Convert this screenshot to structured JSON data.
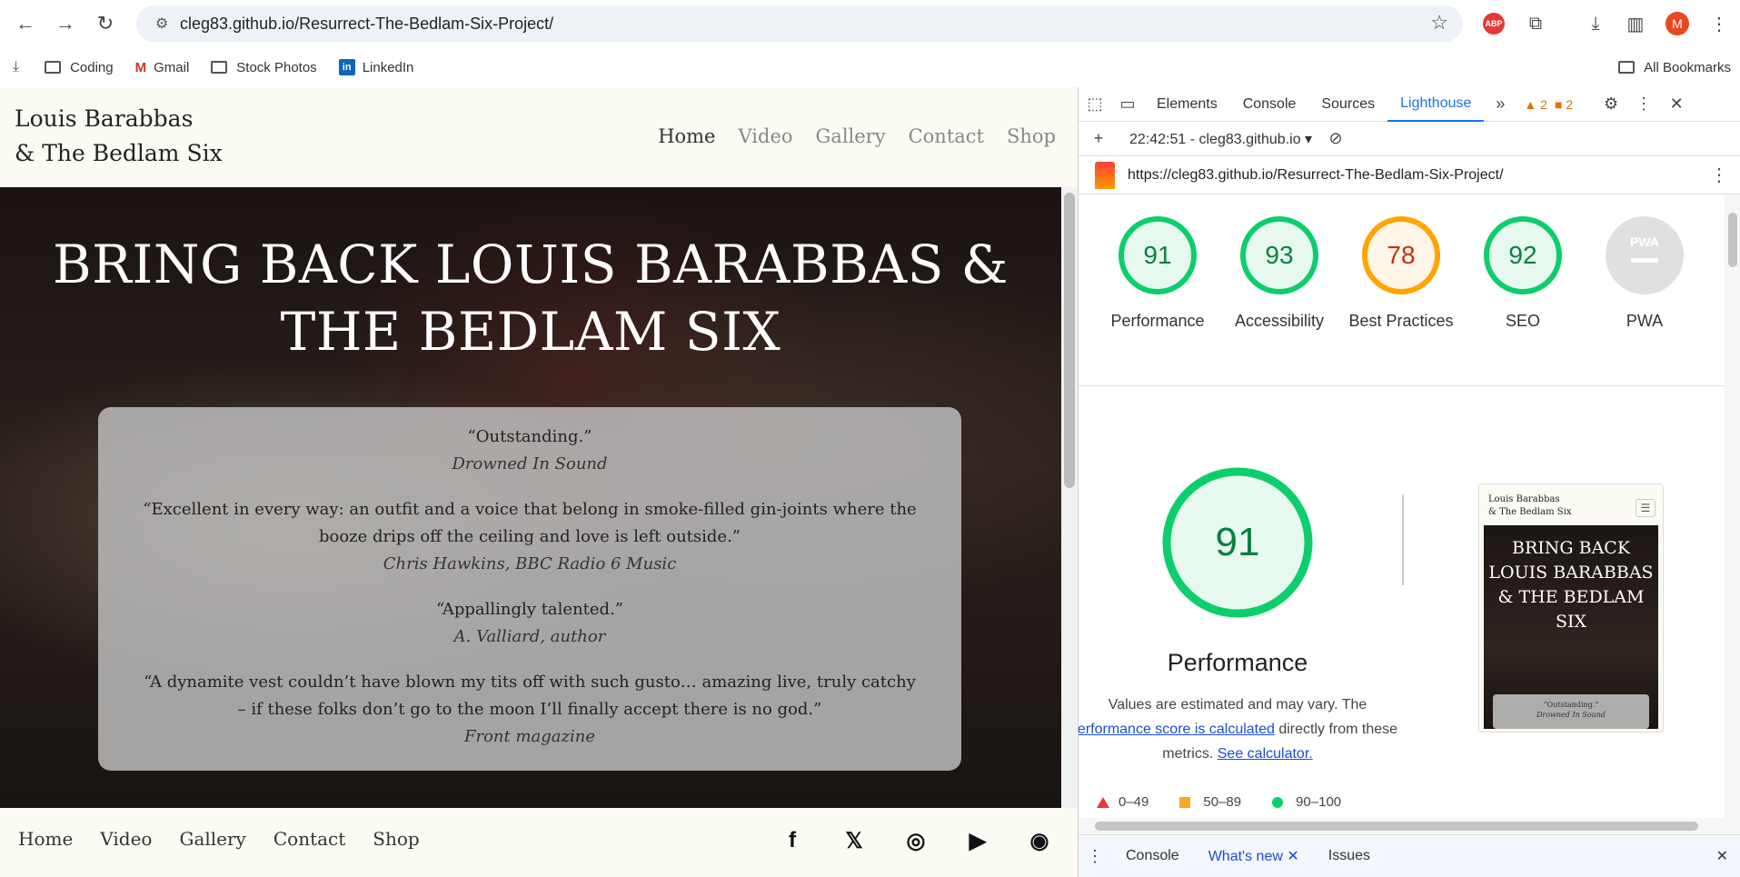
{
  "browser": {
    "url": "cleg83.github.io/Resurrect-The-Bedlam-Six-Project/",
    "avatar_letter": "M",
    "abp_label": "ABP",
    "bookmarks": [
      "Coding",
      "Gmail",
      "Stock Photos",
      "LinkedIn"
    ],
    "all_bookmarks": "All Bookmarks"
  },
  "site": {
    "logo_line1": "Louis Barabbas",
    "logo_line2": "& The Bedlam Six",
    "nav": [
      "Home",
      "Video",
      "Gallery",
      "Contact",
      "Shop"
    ],
    "hero_title": "BRING BACK LOUIS BARABBAS & THE BEDLAM SIX",
    "quotes": [
      {
        "text": "“Outstanding.”",
        "source": "Drowned In Sound"
      },
      {
        "text": "“Excellent in every way: an outfit and a voice that belong in smoke-filled gin-joints where the booze drips off the ceiling and love is left outside.”",
        "source": "Chris Hawkins, BBC Radio 6 Music"
      },
      {
        "text": "“Appallingly talented.”",
        "source": "A. Valliard, author"
      },
      {
        "text": "“A dynamite vest couldn’t have blown my tits off with such gusto… amazing live, truly catchy – if these folks don’t go to the moon I’ll finally accept there is no god.”",
        "source": "Front magazine"
      }
    ],
    "footer_nav": [
      "Home",
      "Video",
      "Gallery",
      "Contact",
      "Shop"
    ],
    "socials": [
      "facebook-icon",
      "x-icon",
      "instagram-icon",
      "youtube-icon",
      "compass-icon"
    ]
  },
  "devtools": {
    "tabs": [
      "Elements",
      "Console",
      "Sources",
      "Lighthouse"
    ],
    "active_tab": "Lighthouse",
    "warnings_count": "2",
    "issues_count": "2",
    "report_time": "22:42:51 - cleg83.github.io",
    "report_url": "https://cleg83.github.io/Resurrect-The-Bedlam-Six-Project/",
    "scores": [
      {
        "label": "Performance",
        "value": "91",
        "status": "pass"
      },
      {
        "label": "Accessibility",
        "value": "93",
        "status": "pass"
      },
      {
        "label": "Best Practices",
        "value": "78",
        "status": "average"
      },
      {
        "label": "SEO",
        "value": "92",
        "status": "pass"
      },
      {
        "label": "PWA",
        "value": "PWA",
        "status": "na"
      }
    ],
    "perf_score": "91",
    "perf_title": "Performance",
    "perf_desc_1": "Values are estimated and may vary. The",
    "perf_link": "erformance score is calculated",
    "perf_desc_2": " directly from these",
    "perf_desc_3": "metrics. ",
    "perf_calc_link": "See calculator.",
    "thumb_logo_1": "Louis Barabbas",
    "thumb_logo_2": "& The Bedlam Six",
    "thumb_title": "BRING BACK LOUIS BARABBAS & THE BEDLAM SIX",
    "thumb_quote": "“Outstanding.”",
    "thumb_quote_src": "Drowned In Sound",
    "legend": [
      "0–49",
      "50–89",
      "90–100"
    ],
    "drawer_tabs": [
      "Console",
      "What's new",
      "Issues"
    ]
  }
}
